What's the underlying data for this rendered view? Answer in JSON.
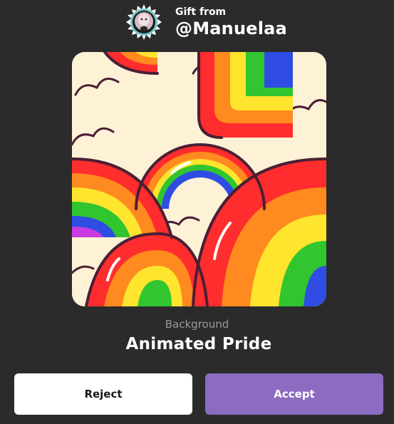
{
  "gift": {
    "from_label": "Gift from",
    "username": "@Manuelaa"
  },
  "avatar": {
    "icon": "user-avatar-icon"
  },
  "preview": {
    "icon": "rainbow-pattern-artwork"
  },
  "item": {
    "type_label": "Background",
    "name": "Animated Pride"
  },
  "actions": {
    "reject_label": "Reject",
    "accept_label": "Accept"
  },
  "colors": {
    "background": "#2b2b2b",
    "accept": "#8b6cc0",
    "reject": "#ffffff",
    "muted_text": "#9a9a9a"
  }
}
